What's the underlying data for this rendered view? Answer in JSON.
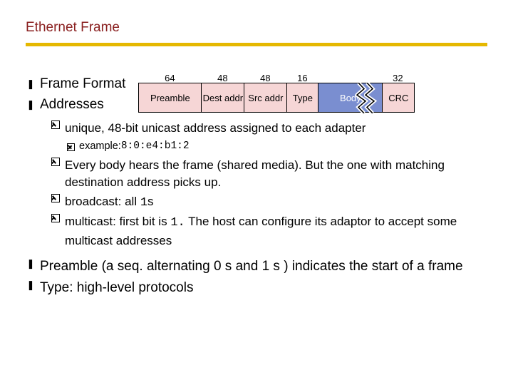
{
  "title": "Ethernet Frame",
  "bullets": {
    "frame_format": "Frame Format",
    "addresses": "Addresses",
    "preamble": "Preamble (a seq. alternating 0 s and 1 s ) indicates the start of a frame",
    "type": "Type: high-level protocols"
  },
  "addr_sub": {
    "unique": "unique, 48-bit unicast address assigned to each adapter",
    "example_label": "example: ",
    "example_value": "8:0:e4:b1:2",
    "everybody": "Every body hears the frame (shared media). But the one with matching destination address picks up.",
    "broadcast_pre": "broadcast: all ",
    "broadcast_code": "1",
    "broadcast_post": "s",
    "multicast_pre": "multicast: first bit is ",
    "multicast_code": "1.",
    "multicast_post": "  The host can configure its adaptor to accept some multicast addresses"
  },
  "diagram": {
    "bits": {
      "preamble": "64",
      "dest": "48",
      "src": "48",
      "type": "16",
      "body": "",
      "crc": "32"
    },
    "labels": {
      "preamble": "Preamble",
      "dest": "Dest addr",
      "src": "Src addr",
      "type": "Type",
      "body": "Body",
      "crc": "CRC"
    }
  }
}
